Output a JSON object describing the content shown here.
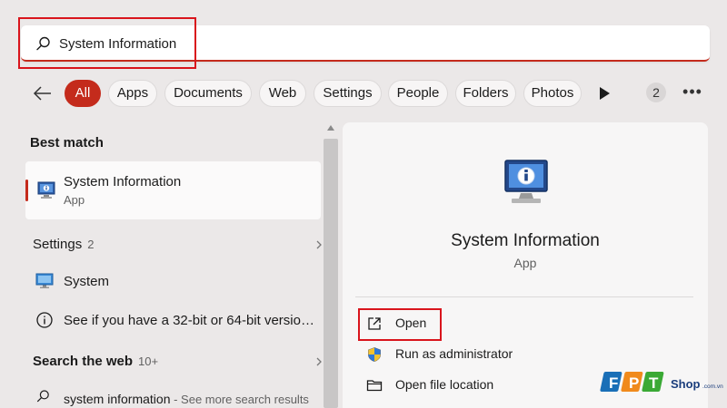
{
  "search": {
    "value": "System Information",
    "placeholder": ""
  },
  "filters": {
    "chips": [
      "All",
      "Apps",
      "Documents",
      "Web",
      "Settings",
      "People",
      "Folders",
      "Photos"
    ],
    "active": "All",
    "count": "2"
  },
  "results": {
    "best_match_heading": "Best match",
    "best_match": {
      "title": "System Information",
      "type": "App"
    },
    "settings_heading": "Settings",
    "settings_count": "2",
    "settings_items": [
      "System",
      "See if you have a 32-bit or 64-bit versio…"
    ],
    "web_heading": "Search the web",
    "web_count": "10+",
    "web_item": {
      "query": "system information",
      "suffix": " - See more search results"
    }
  },
  "detail": {
    "title": "System Information",
    "type": "App",
    "actions": [
      "Open",
      "Run as administrator",
      "Open file location"
    ]
  },
  "logo": {
    "brand": "FPT",
    "shop": "Shop",
    "domain": ".com.vn"
  },
  "icons": {
    "search": "search-icon",
    "back": "arrow-left-icon",
    "play": "play-icon",
    "more": "more-icon",
    "system_info": "system-info-icon",
    "system": "monitor-icon",
    "info": "info-icon",
    "web_search": "search-icon",
    "open": "external-link-icon",
    "run_admin": "shield-icon",
    "folder": "folder-icon",
    "chevron": "chevron-right-icon"
  },
  "colors": {
    "accent": "#c42b1c",
    "highlight": "#d9141c",
    "brand_blue": "#1a6fb7",
    "brand_orange": "#f08a1c",
    "brand_green": "#3aa935"
  }
}
